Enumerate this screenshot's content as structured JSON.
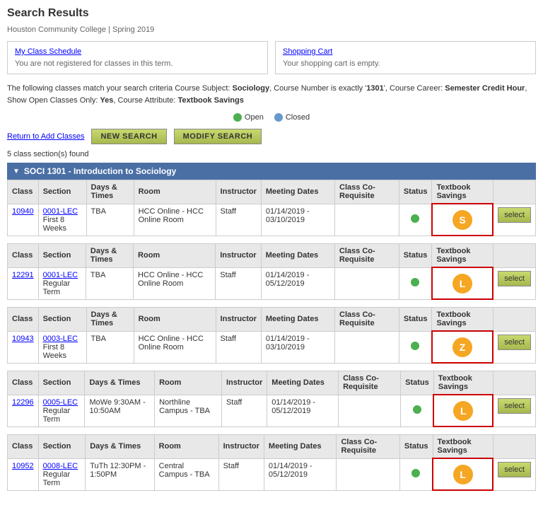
{
  "page": {
    "title": "Search Results",
    "subtitle": "Houston Community College | Spring 2019"
  },
  "info_boxes": [
    {
      "link": "My Class Schedule",
      "text": "You are not registered for classes in this term."
    },
    {
      "link": "Shopping Cart",
      "text": "Your shopping cart is empty."
    }
  ],
  "criteria": {
    "text": "The following classes match your search criteria Course Subject: Sociology, Course Number is exactly '1301', Course Career: Semester Credit Hour, Show Open Classes Only: Yes, Course Attribute: Textbook Savings"
  },
  "legend": {
    "open_label": "Open",
    "closed_label": "Closed"
  },
  "nav": {
    "return_link": "Return to Add Classes",
    "new_search_btn": "New Search",
    "modify_search_btn": "Modify Search"
  },
  "results": {
    "found_text": "5 class section(s) found"
  },
  "course": {
    "header": "SOCI 1301 - Introduction to Sociology"
  },
  "columns": {
    "class": "Class",
    "section": "Section",
    "days_times": "Days & Times",
    "room": "Room",
    "instructor": "Instructor",
    "meeting_dates": "Meeting Dates",
    "co_req": "Class Co-Requisite",
    "status": "Status",
    "textbook_savings": "Textbook Savings",
    "select": ""
  },
  "classes": [
    {
      "class_num": "10940",
      "section": "0001-LEC",
      "section_sub": "First 8 Weeks",
      "days_times": "TBA",
      "room": "HCC Online - HCC Online Room",
      "instructor": "Staff",
      "meeting_dates": "01/14/2019 - 03/10/2019",
      "co_req": "",
      "status": "open",
      "tb_icon": "S",
      "tb_icon_type": "s"
    },
    {
      "class_num": "12291",
      "section": "0001-LEC",
      "section_sub": "Regular Term",
      "days_times": "TBA",
      "room": "HCC Online - HCC Online Room",
      "instructor": "Staff",
      "meeting_dates": "01/14/2019 - 05/12/2019",
      "co_req": "",
      "status": "open",
      "tb_icon": "L",
      "tb_icon_type": "l"
    },
    {
      "class_num": "10943",
      "section": "0003-LEC",
      "section_sub": "First 8 Weeks",
      "days_times": "TBA",
      "room": "HCC Online - HCC Online Room",
      "instructor": "Staff",
      "meeting_dates": "01/14/2019 - 03/10/2019",
      "co_req": "",
      "status": "open",
      "tb_icon": "Z",
      "tb_icon_type": "z"
    },
    {
      "class_num": "12296",
      "section": "0005-LEC",
      "section_sub": "Regular Term",
      "days_times": "MoWe 9:30AM - 10:50AM",
      "room": "Northline Campus - TBA",
      "instructor": "Staff",
      "meeting_dates": "01/14/2019 - 05/12/2019",
      "co_req": "",
      "status": "open",
      "tb_icon": "L",
      "tb_icon_type": "l"
    },
    {
      "class_num": "10952",
      "section": "0008-LEC",
      "section_sub": "Regular Term",
      "days_times": "TuTh 12:30PM - 1:50PM",
      "room": "Central Campus - TBA",
      "instructor": "Staff",
      "meeting_dates": "01/14/2019 - 05/12/2019",
      "co_req": "",
      "status": "open",
      "tb_icon": "L",
      "tb_icon_type": "l"
    }
  ],
  "select_btn_label": "select"
}
